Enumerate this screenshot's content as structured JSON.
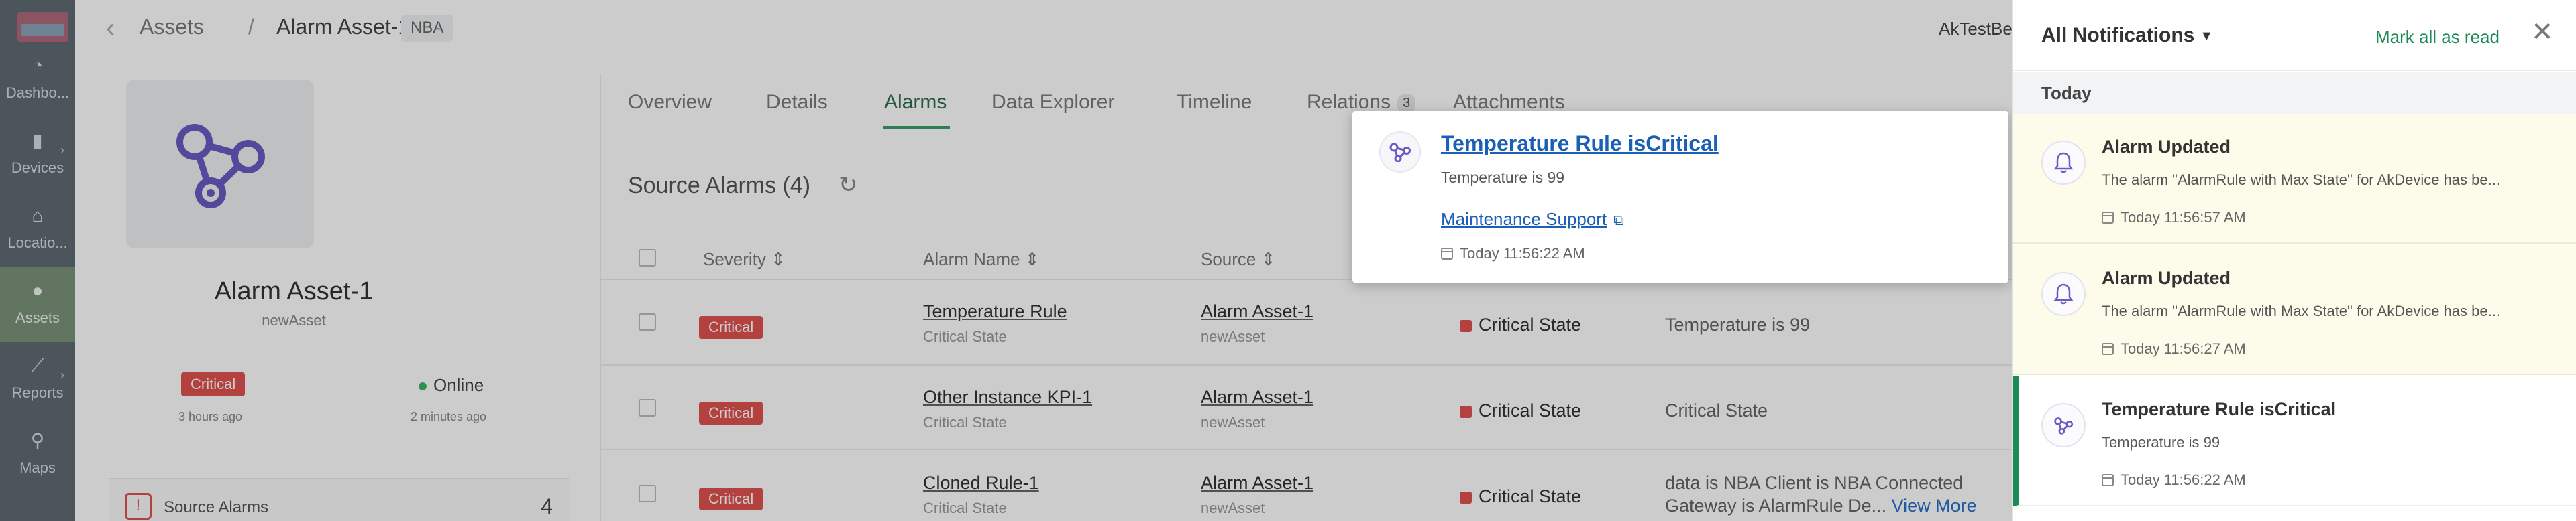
{
  "sidebar": {
    "items": [
      {
        "label": "Dashbo...",
        "icon": "dashboard-icon",
        "glyph": "◔"
      },
      {
        "label": "Devices",
        "icon": "devices-icon",
        "glyph": "▮",
        "caret": "›"
      },
      {
        "label": "Locatio...",
        "icon": "location-icon",
        "glyph": "⌂"
      },
      {
        "label": "Assets",
        "icon": "assets-icon",
        "glyph": "●"
      },
      {
        "label": "Reports",
        "icon": "reports-icon",
        "glyph": "⟋",
        "caret": "›"
      },
      {
        "label": "Maps",
        "icon": "maps-icon",
        "glyph": "⚲"
      }
    ]
  },
  "header": {
    "breadcrumb_root": "Assets",
    "breadcrumb_sep": "/",
    "breadcrumb_current": "Alarm Asset-1",
    "tag": "NBA",
    "user": "AkTestBe"
  },
  "asset": {
    "name": "Alarm Asset-1",
    "type": "newAsset",
    "alarm_badge": "Critical",
    "alarm_time": "3 hours ago",
    "status": "Online",
    "status_time": "2 minutes ago",
    "source_alarms_label": "Source Alarms",
    "source_alarms_count": "4"
  },
  "tabs": [
    {
      "label": "Overview"
    },
    {
      "label": "Details"
    },
    {
      "label": "Alarms",
      "active": true
    },
    {
      "label": "Data Explorer"
    },
    {
      "label": "Timeline"
    },
    {
      "label": "Relations",
      "badge": "3"
    },
    {
      "label": "Attachments"
    }
  ],
  "alarms": {
    "title": "Source Alarms (4)",
    "columns": {
      "severity": "Severity",
      "name": "Alarm Name",
      "source": "Source"
    },
    "rows": [
      {
        "severity": "Critical",
        "name": "Temperature Rule",
        "name_sub": "Critical State",
        "source": "Alarm Asset-1",
        "source_sub": "newAsset",
        "status": "Critical State",
        "details": "Temperature is 99",
        "details_2": ""
      },
      {
        "severity": "Critical",
        "name": "Other Instance KPI-1",
        "name_sub": "Critical State",
        "source": "Alarm Asset-1",
        "source_sub": "newAsset",
        "status": "Critical State",
        "details": "Critical State",
        "details_2": ""
      },
      {
        "severity": "Critical",
        "name": "Cloned Rule-1",
        "name_sub": "Critical State",
        "source": "Alarm Asset-1",
        "source_sub": "newAsset",
        "status": "Critical State",
        "details": "data is NBA Client is NBA Connected",
        "details_2": "Gateway is AlarmRule De...",
        "view_more": "View More"
      }
    ]
  },
  "popup": {
    "title": "Temperature Rule isCritical",
    "message": "Temperature is 99",
    "link": "Maintenance Support",
    "time": "Today 11:56:22 AM"
  },
  "notifications": {
    "title": "All Notifications",
    "mark_all": "Mark all as read",
    "group": "Today",
    "items": [
      {
        "title": "Alarm Updated",
        "body": "The alarm \"AlarmRule with Max State\" for AkDevice has be...",
        "time": "Today 11:56:57 AM"
      },
      {
        "title": "Alarm Updated",
        "body": "The alarm \"AlarmRule with Max State\" for AkDevice has be...",
        "time": "Today 11:56:27 AM"
      },
      {
        "title": "Temperature Rule isCritical",
        "body": "Temperature is 99",
        "time": "Today 11:56:22 AM"
      }
    ]
  },
  "colors": {
    "accent": "#1d8a55",
    "critical": "#e0524f",
    "link": "#1c5fb6",
    "sidebar": "#5f6b74",
    "unread_bg": "#fdfbea"
  }
}
